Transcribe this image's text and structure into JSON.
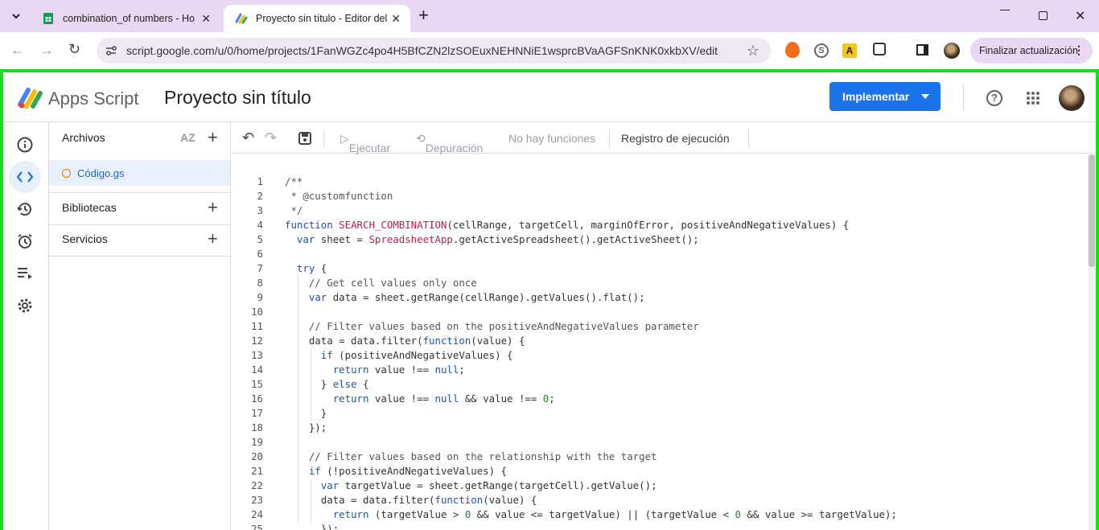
{
  "browser": {
    "tabs": [
      {
        "title": "combination_of numbers - Hoja",
        "active": false
      },
      {
        "title": "Proyecto sin título - Editor del p",
        "active": true
      }
    ],
    "url": "script.google.com/u/0/home/projects/1FanWGZc4po4H5BfCZN2lzSOEuxNEHNNiE1wsprcBVaAGFSnKNK0xkbXV/edit",
    "update_button": "Finalizar actualización"
  },
  "app": {
    "brand": "Apps Script",
    "project_title": "Proyecto sin título",
    "deploy_label": "Implementar"
  },
  "files_panel": {
    "files_header": "Archivos",
    "file_name": "Código.gs",
    "libraries": "Bibliotecas",
    "services": "Servicios"
  },
  "editor_toolbar": {
    "run": "Ejecutar",
    "debug": "Depuración",
    "no_functions": "No hay funciones",
    "log": "Registro de ejecución"
  },
  "code_lines": [
    "/**",
    " * @customfunction",
    " */",
    "function SEARCH_COMBINATION(cellRange, targetCell, marginOfError, positiveAndNegativeValues) {",
    "  var sheet = SpreadsheetApp.getActiveSpreadsheet().getActiveSheet();",
    "",
    "  try {",
    "    // Get cell values only once",
    "    var data = sheet.getRange(cellRange).getValues().flat();",
    "",
    "    // Filter values based on the positiveAndNegativeValues parameter",
    "    data = data.filter(function(value) {",
    "      if (positiveAndNegativeValues) {",
    "        return value !== null;",
    "      } else {",
    "        return value !== null && value !== 0;",
    "      }",
    "    });",
    "",
    "    // Filter values based on the relationship with the target",
    "    if (!positiveAndNegativeValues) {",
    "      var targetValue = sheet.getRange(targetCell).getValue();",
    "      data = data.filter(function(value) {",
    "        return (targetValue > 0 && value <= targetValue) || (targetValue < 0 && value >= targetValue);",
    "      });"
  ],
  "line_numbers": [
    "1",
    "2",
    "3",
    "4",
    "5",
    "6",
    "7",
    "8",
    "9",
    "10",
    "11",
    "12",
    "13",
    "14",
    "15",
    "16",
    "17",
    "18",
    "19",
    "20",
    "21",
    "22",
    "23",
    "24",
    "25"
  ],
  "colors": {
    "deploy_bg": "#1a73e8",
    "frame_border": "#14e01a",
    "tabbar_bg": "#e9d7f3"
  }
}
